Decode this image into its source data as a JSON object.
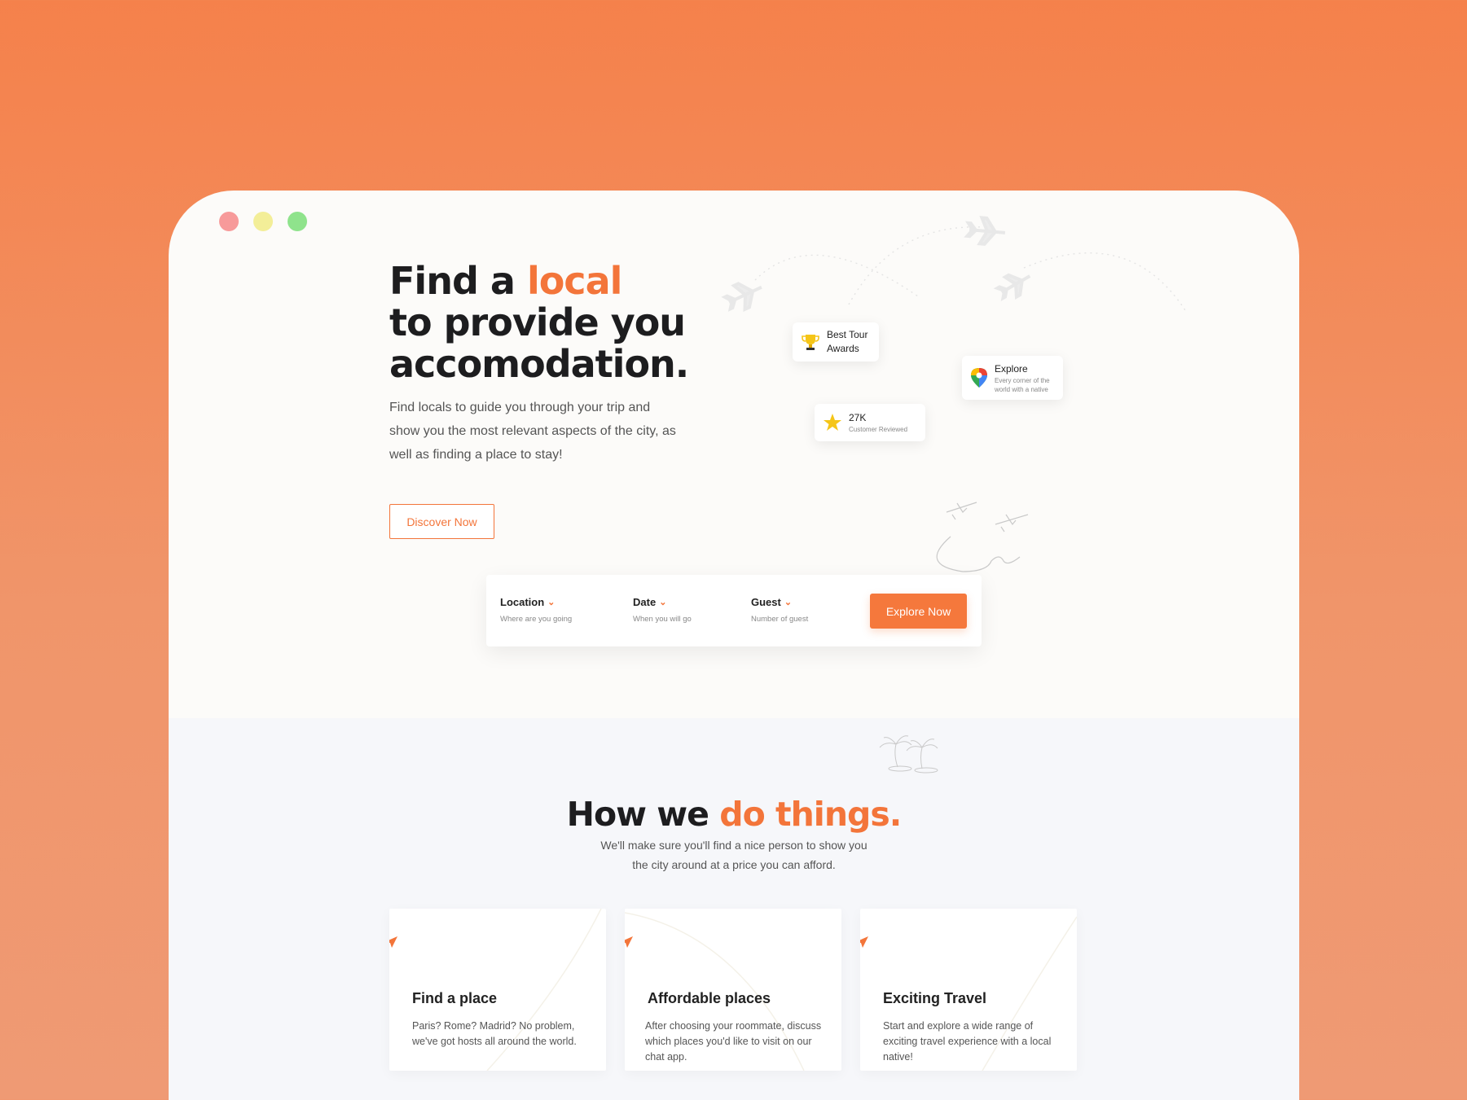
{
  "window": {
    "controls": [
      "close",
      "minimize",
      "maximize"
    ]
  },
  "hero": {
    "title_prefix": "Find a ",
    "title_accent": "local",
    "title_line2": "to provide you",
    "title_line3": "accomodation.",
    "description": "Find locals to guide you through your trip and show you the most relevant aspects of the city, as well as finding a place to stay!",
    "discover_button": "Discover Now"
  },
  "badges": {
    "awards": {
      "title": "Best Tour Awards",
      "icon": "trophy-icon"
    },
    "explore": {
      "title": "Explore",
      "subtitle": "Every corner of the world with a native",
      "icon": "map-pin-icon"
    },
    "reviews": {
      "title": "27K",
      "subtitle": "Customer Reviewed",
      "icon": "star-icon"
    }
  },
  "search": {
    "location": {
      "label": "Location",
      "hint": "Where are you going"
    },
    "date": {
      "label": "Date",
      "hint": "When you will go"
    },
    "guest": {
      "label": "Guest",
      "hint": "Number of guest"
    },
    "explore_button": "Explore Now"
  },
  "how": {
    "title_prefix": "How we ",
    "title_accent": "do things.",
    "subtitle_line1": "We'll make sure you'll find a nice person to show you",
    "subtitle_line2": "the city around at a price you can afford.",
    "cards": [
      {
        "title": "Find a place",
        "text": "Paris? Rome? Madrid? No problem, we've got hosts all around the world."
      },
      {
        "title": "Affordable places",
        "text": "After choosing your roommate, discuss which places you'd like to visit on our chat app."
      },
      {
        "title": "Exciting Travel",
        "text": "Start and explore a wide range of exciting travel experience with a local native!"
      }
    ]
  },
  "colors": {
    "accent": "#f3753a",
    "background": "#f5814b",
    "window": "#fcfbf9",
    "section": "#f6f7fa"
  }
}
